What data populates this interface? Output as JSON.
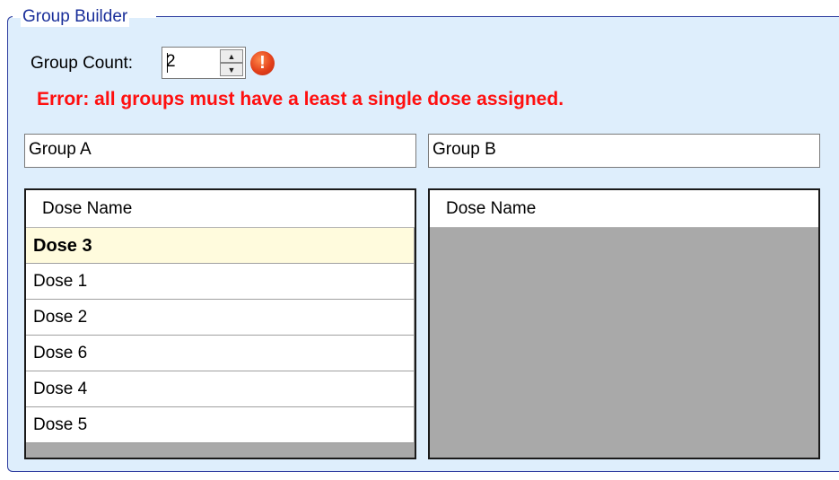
{
  "group_builder": {
    "title": "Group Builder",
    "group_count_label": "Group Count:",
    "group_count_value": "2",
    "error_icon": "error-icon",
    "error_message": "Error: all groups must have a least a single dose assigned."
  },
  "groups": [
    {
      "name": "Group A",
      "column_header": "Dose Name",
      "doses": [
        "Dose 3",
        "Dose 1",
        "Dose 2",
        "Dose 6",
        "Dose 4",
        "Dose 5"
      ],
      "selected": "Dose 3"
    },
    {
      "name": "Group B",
      "column_header": "Dose Name",
      "doses": []
    }
  ],
  "colors": {
    "legend": "#1a2f9a",
    "panel_bg": "#deeefc",
    "error_text": "#ff0f0f",
    "selected_row": "#fffbdd",
    "grid_empty": "#a9a9a9"
  }
}
